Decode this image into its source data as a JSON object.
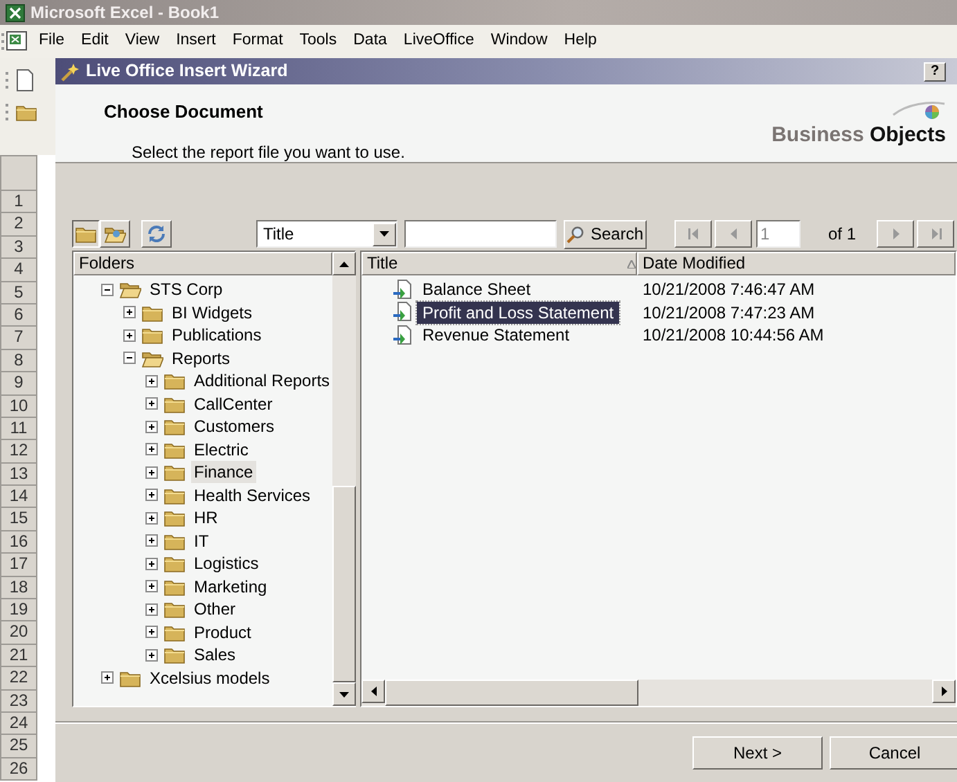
{
  "app_window": {
    "title": "Microsoft Excel - Book1"
  },
  "menu": [
    "File",
    "Edit",
    "View",
    "Insert",
    "Format",
    "Tools",
    "Data",
    "LiveOffice",
    "Window",
    "Help"
  ],
  "row_headers": [
    "1",
    "2",
    "3",
    "4",
    "5",
    "6",
    "7",
    "8",
    "9",
    "10",
    "11",
    "12",
    "13",
    "14",
    "15",
    "16",
    "17",
    "18",
    "19",
    "20",
    "21",
    "22",
    "23",
    "24",
    "25",
    "26"
  ],
  "dialog": {
    "title": "Live Office Insert Wizard",
    "help": "?",
    "heading": "Choose Document",
    "instruction": "Select the report file you want to use.",
    "logo": "Business **Objects**"
  },
  "toolbar": {
    "search_by": "Title",
    "search_button": "Search",
    "page": "1",
    "page_total": "of 1"
  },
  "folders": {
    "header": "Folders",
    "tree": [
      {
        "label": "STS Corp",
        "expanded": true,
        "selected": false,
        "children": [
          {
            "label": "BI Widgets",
            "expanded": false,
            "selected": false
          },
          {
            "label": "Publications",
            "expanded": false,
            "selected": false
          },
          {
            "label": "Reports",
            "expanded": true,
            "selected": false,
            "children": [
              {
                "label": "Additional Reports",
                "expanded": false,
                "selected": false
              },
              {
                "label": "CallCenter",
                "expanded": false,
                "selected": false
              },
              {
                "label": "Customers",
                "expanded": false,
                "selected": false
              },
              {
                "label": "Electric",
                "expanded": false,
                "selected": false
              },
              {
                "label": "Finance",
                "expanded": false,
                "selected": true
              },
              {
                "label": "Health Services",
                "expanded": false,
                "selected": false
              },
              {
                "label": "HR",
                "expanded": false,
                "selected": false
              },
              {
                "label": "IT",
                "expanded": false,
                "selected": false
              },
              {
                "label": "Logistics",
                "expanded": false,
                "selected": false
              },
              {
                "label": "Marketing",
                "expanded": false,
                "selected": false
              },
              {
                "label": "Other",
                "expanded": false,
                "selected": false
              },
              {
                "label": "Product",
                "expanded": false,
                "selected": false
              },
              {
                "label": "Sales",
                "expanded": false,
                "selected": false
              }
            ]
          }
        ]
      },
      {
        "label": "Xcelsius models",
        "expanded": false,
        "selected": false
      }
    ]
  },
  "documents": {
    "columns": [
      "Title",
      "Date Modified"
    ],
    "rows": [
      {
        "title": "Balance Sheet",
        "date": "10/21/2008 7:46:47 AM",
        "selected": false
      },
      {
        "title": "Profit and Loss Statement",
        "date": "10/21/2008 7:47:23 AM",
        "selected": true
      },
      {
        "title": "Revenue Statement",
        "date": "10/21/2008 10:44:56 AM",
        "selected": false
      }
    ]
  },
  "buttons": [
    "Next >",
    "Cancel"
  ]
}
